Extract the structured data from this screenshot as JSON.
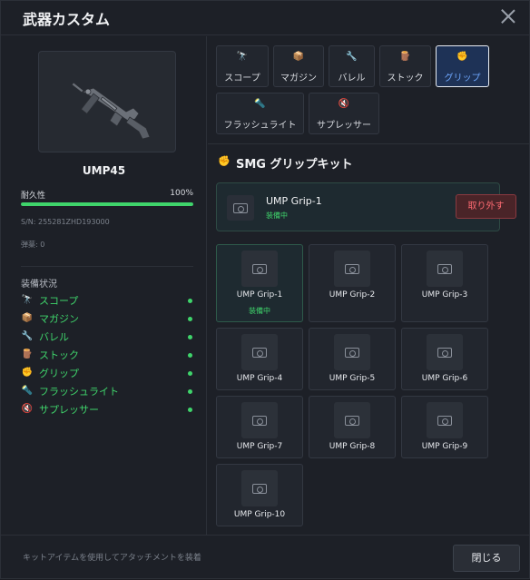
{
  "dialog": {
    "title": "武器カスタム"
  },
  "weapon": {
    "name": "UMP45",
    "durability_label": "耐久性",
    "durability_value": "100%",
    "durability_fraction": 1.0,
    "serial": "S/N: 255281ZHD193000",
    "ammo": "弾薬: 0"
  },
  "equipment_status": {
    "title": "装備状況",
    "items": [
      {
        "label": "スコープ",
        "icon": "telescope-icon",
        "glyph": "🔭"
      },
      {
        "label": "マガジン",
        "icon": "box-icon",
        "glyph": "📦"
      },
      {
        "label": "バレル",
        "icon": "wrench-icon",
        "glyph": "🔧"
      },
      {
        "label": "ストック",
        "icon": "wood-icon",
        "glyph": "🪵"
      },
      {
        "label": "グリップ",
        "icon": "fist-icon",
        "glyph": "✊"
      },
      {
        "label": "フラッシュライト",
        "icon": "flashlight-icon",
        "glyph": "🔦"
      },
      {
        "label": "サプレッサー",
        "icon": "muted-speaker-icon",
        "glyph": "🔇"
      }
    ]
  },
  "tabs": [
    {
      "label": "スコープ",
      "icon": "telescope-icon",
      "glyph": "🔭"
    },
    {
      "label": "マガジン",
      "icon": "box-icon",
      "glyph": "📦"
    },
    {
      "label": "バレル",
      "icon": "wrench-icon",
      "glyph": "🔧"
    },
    {
      "label": "ストック",
      "icon": "wood-icon",
      "glyph": "🪵"
    },
    {
      "label": "グリップ",
      "icon": "fist-icon",
      "glyph": "✊",
      "active": true
    },
    {
      "label": "フラッシュライト",
      "icon": "flashlight-icon",
      "glyph": "🔦"
    },
    {
      "label": "サプレッサー",
      "icon": "muted-speaker-icon",
      "glyph": "🔇"
    }
  ],
  "section": {
    "title": "SMG グリップキット",
    "glyph": "✊"
  },
  "equipped": {
    "name": "UMP Grip-1",
    "status": "装備中",
    "remove_label": "取り外す"
  },
  "grips": [
    {
      "label": "UMP Grip-1",
      "sub": "装備中",
      "active": true
    },
    {
      "label": "UMP Grip-2"
    },
    {
      "label": "UMP Grip-3"
    },
    {
      "label": "UMP Grip-4"
    },
    {
      "label": "UMP Grip-5"
    },
    {
      "label": "UMP Grip-6"
    },
    {
      "label": "UMP Grip-7"
    },
    {
      "label": "UMP Grip-8"
    },
    {
      "label": "UMP Grip-9"
    },
    {
      "label": "UMP Grip-10"
    }
  ],
  "footer": {
    "hint": "キットアイテムを使用してアタッチメントを装着",
    "close_label": "閉じる"
  },
  "colors": {
    "accent_green": "#3fd46b",
    "active_tab_bg": "#1e3256",
    "danger": "#ff6b72"
  }
}
